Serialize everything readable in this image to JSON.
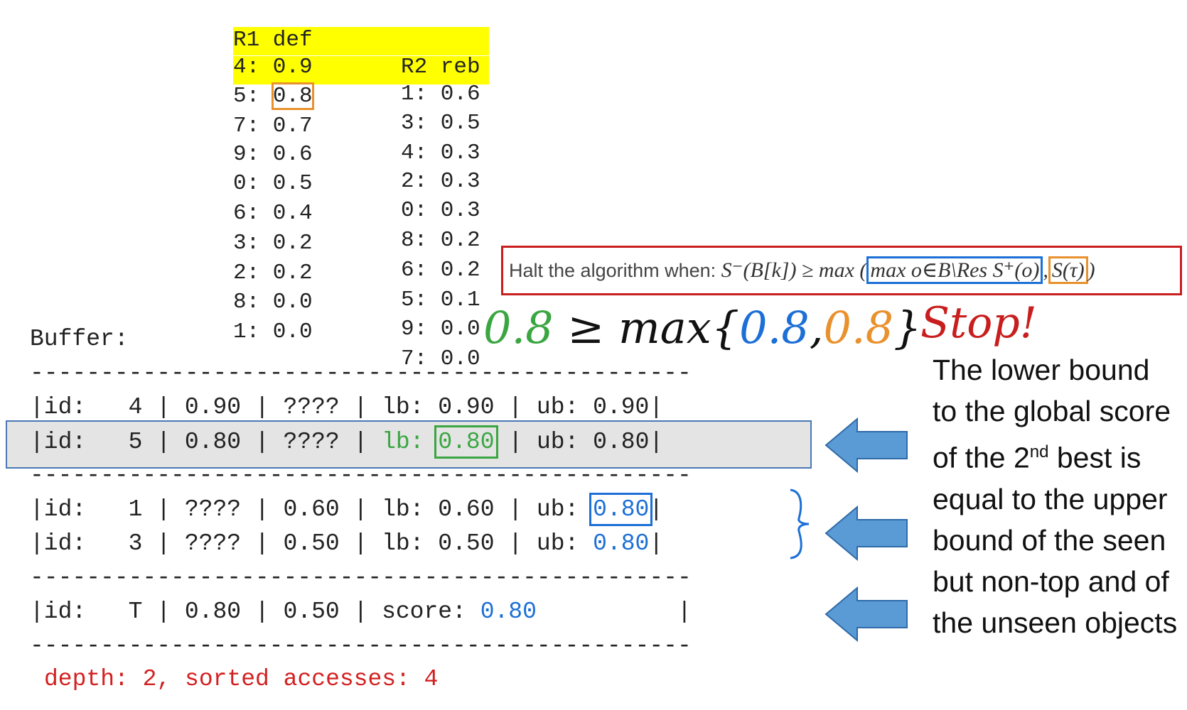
{
  "lists": {
    "header": {
      "r1": "R1 def",
      "r2": "R2 reb"
    },
    "rows": [
      {
        "r1": "4: 0.9",
        "r2": "1: 0.6",
        "highlight": true
      },
      {
        "r1": "5: 0.8",
        "r2": "3: 0.5",
        "highlight": true
      },
      {
        "r1": "7: 0.7",
        "r2": "4: 0.3"
      },
      {
        "r1": "9: 0.6",
        "r2": "2: 0.3"
      },
      {
        "r1": "0: 0.5",
        "r2": "0: 0.3"
      },
      {
        "r1": "6: 0.4",
        "r2": "8: 0.2"
      },
      {
        "r1": "3: 0.2",
        "r2": "6: 0.2"
      },
      {
        "r1": "2: 0.2",
        "r2": "5: 0.1"
      },
      {
        "r1": "8: 0.0",
        "r2": "9: 0.0"
      },
      {
        "r1": "1: 0.0",
        "r2": "7: 0.0"
      }
    ],
    "boxed_prefix": "5: ",
    "boxed_value": "0.8"
  },
  "halt": {
    "text": "Halt the algorithm when: ",
    "lhs": "S⁻(B[k]) ≥ max (",
    "blue_part": "max o∈B\\Res S⁺(o)",
    "comma": ",",
    "orange_part": "S(τ)",
    "close": ")"
  },
  "handwriting": {
    "green": "0.8",
    "ge_max": " ≥ max{",
    "blue": "0.8",
    "comma": ",",
    "orange": "0.8",
    "close": "}",
    "stop": "Stop!"
  },
  "buffer": {
    "title": "Buffer:",
    "divider": "-----------------------------------------------",
    "row1": "|id:   4 | 0.90 | ???? | lb: 0.90 | ub: 0.90|",
    "row2": {
      "a": "|id:   5 | 0.80 | ???? | ",
      "lb_label": "lb: ",
      "lb_value": "0.80",
      "b": " | ub: 0.80|"
    },
    "row3": {
      "a": "|id:   1 | ???? | 0.60 | lb: 0.60 | ub: ",
      "ub": "0.80",
      "end": "|"
    },
    "row4": {
      "a": "|id:   3 | ???? | 0.50 | lb: 0.50 | ub: ",
      "ub": "0.80",
      "end": "|"
    },
    "row5": {
      "a": "|id:   T | 0.80 | 0.50 | score: ",
      "score": "0.80",
      "end": "          |"
    },
    "depth": "depth: 2, sorted accesses: 4"
  },
  "explanation": {
    "part1": "The lower bound to the global score of the 2",
    "sup": "nd",
    "part2": " best is equal to the upper bound of the seen but non-top and of the unseen objects"
  },
  "colors": {
    "yellow": "#ffff00",
    "red": "#c81e1e",
    "blue": "#1c6fd6",
    "green": "#3aa641",
    "orange": "#e8912d"
  }
}
